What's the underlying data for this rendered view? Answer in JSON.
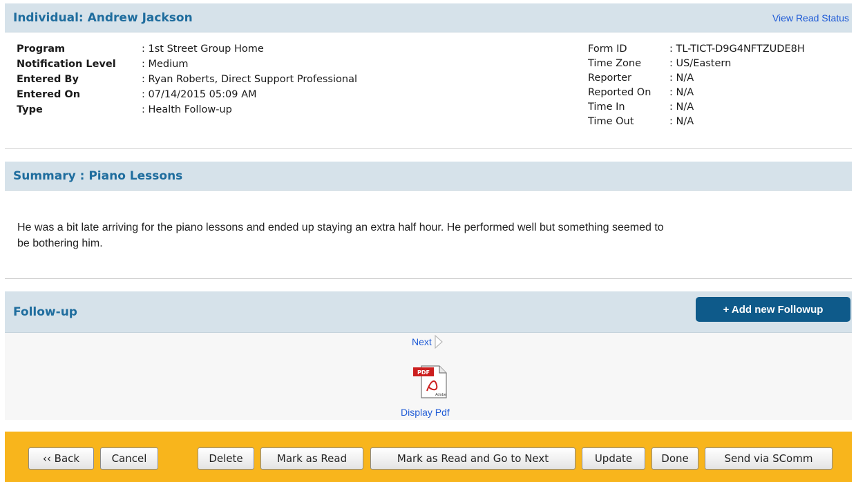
{
  "header": {
    "title": "Individual: Andrew Jackson",
    "read_status_link": "View Read Status"
  },
  "info_left": [
    {
      "label": "Program",
      "value": ": 1st Street Group Home"
    },
    {
      "label": "Notification Level",
      "value": ": Medium"
    },
    {
      "label": "Entered By",
      "value": ": Ryan Roberts, Direct Support Professional"
    },
    {
      "label": "Entered On",
      "value": ": 07/14/2015 05:09 AM"
    },
    {
      "label": "Type",
      "value": ": Health Follow-up"
    }
  ],
  "info_right": [
    {
      "label": "Form ID",
      "value": ": TL-TICT-D9G4NFTZUDE8H"
    },
    {
      "label": "Time Zone",
      "value": ": US/Eastern"
    },
    {
      "label": "Reporter",
      "value": ": N/A"
    },
    {
      "label": "Reported On",
      "value": ": N/A"
    },
    {
      "label": "Time In",
      "value": ": N/A"
    },
    {
      "label": "Time Out",
      "value": ": N/A"
    }
  ],
  "summary": {
    "title": "Summary : Piano Lessons",
    "text": "He was a bit late arriving for the piano lessons and ended up staying an extra half hour. He performed well but something seemed to be bothering him."
  },
  "followup": {
    "title": "Follow-up",
    "add_button": "+ Add new Followup",
    "next_link": "Next",
    "pdf_label": "Display Pdf",
    "pdf_icon_text": "PDF",
    "pdf_brand_text": "Adobe"
  },
  "footer_buttons": {
    "back": "‹‹ Back",
    "cancel": "Cancel",
    "delete": "Delete",
    "mark_read": "Mark as Read",
    "mark_read_next": "Mark as Read and Go to Next",
    "update": "Update",
    "done": "Done",
    "send_scomm": "Send via SComm"
  },
  "colors": {
    "header_bar": "#d6e2ea",
    "title_text": "#1f6d9e",
    "link": "#1f5bd6",
    "add_button": "#0e5a8a",
    "footer_bar": "#f8b51c"
  }
}
